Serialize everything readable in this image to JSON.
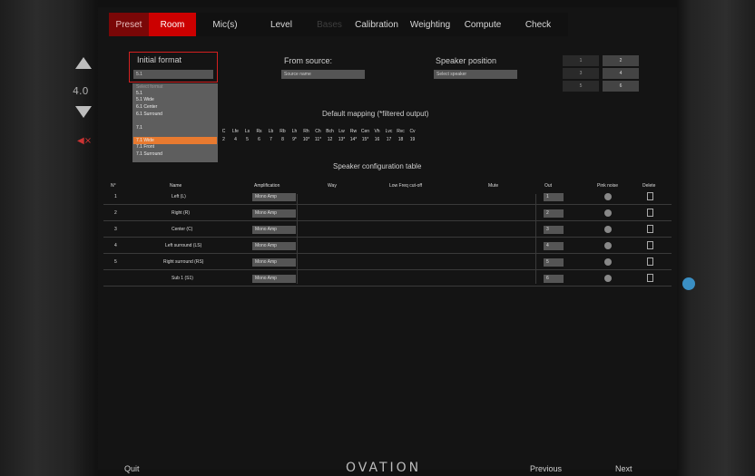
{
  "tabs": [
    {
      "label": "Preset",
      "state": "inactive"
    },
    {
      "label": "Room",
      "state": "active"
    },
    {
      "label": "Mic(s)",
      "state": "normal"
    },
    {
      "label": "Level",
      "state": "normal"
    },
    {
      "label": "Bases",
      "state": "disabled"
    },
    {
      "label": "Calibration",
      "state": "normal"
    },
    {
      "label": "Weighting",
      "state": "normal"
    },
    {
      "label": "Compute",
      "state": "normal"
    },
    {
      "label": "Check",
      "state": "normal"
    }
  ],
  "side": {
    "zoom": "4.0",
    "mute": "◀×"
  },
  "room": {
    "initial_format_label": "Initial format",
    "initial_format_value": "5.1",
    "from_source_label": "From source:",
    "from_source_value": "Source name",
    "speaker_position_label": "Speaker position",
    "speaker_position_value": "Select speaker",
    "dropdown_header": "Select format",
    "dropdown_items": [
      "5.1",
      "5.1 Wide",
      "6.1 Center",
      "6.1 Surround",
      "7.1",
      "7.1 Wide",
      "7.1 Front",
      "7.1 Surround"
    ],
    "dropdown_selected_index": 5,
    "view_buttons": [
      "1",
      "2",
      "3",
      "4",
      "5",
      "6"
    ]
  },
  "mapping": {
    "title": "Default mapping (*filtered output)",
    "labels": [
      "C",
      "Lfe",
      "Ls",
      "Rs",
      "Lb",
      "Rb",
      "Lh",
      "Rh",
      "Ch",
      "Bch",
      "Lw",
      "Rw",
      "Cen",
      "Vh",
      "Lvc",
      "Rvc",
      "Cv"
    ],
    "values": [
      "2",
      "4",
      "5",
      "6",
      "7",
      "8",
      "9*",
      "10*",
      "11*",
      "12",
      "13*",
      "14*",
      "15*",
      "16",
      "17",
      "18",
      "19"
    ]
  },
  "config": {
    "title": "Speaker configuration table",
    "headers": [
      "N°",
      "Name",
      "Amplification",
      "Way",
      "Low Freq cut-off",
      "Mute",
      "Out",
      "Pink noise",
      "Delete"
    ],
    "rows": [
      {
        "n": "1",
        "name": "Left (L)",
        "amp": "Mono Amp",
        "out": "1"
      },
      {
        "n": "2",
        "name": "Right (R)",
        "amp": "Mono Amp",
        "out": "2"
      },
      {
        "n": "3",
        "name": "Center (C)",
        "amp": "Mono Amp",
        "out": "3"
      },
      {
        "n": "4",
        "name": "Left surround (LS)",
        "amp": "Mono Amp",
        "out": "4"
      },
      {
        "n": "5",
        "name": "Right surround (RS)",
        "amp": "Mono Amp",
        "out": "5"
      },
      {
        "n": "",
        "name": "Sub 1 (S1)",
        "amp": "Mono Amp",
        "out": "6"
      }
    ]
  },
  "footer": {
    "quit": "Quit",
    "logo": "OVATION",
    "previous": "Previous",
    "next": "Next"
  },
  "colors": {
    "accent": "#cc0000",
    "highlight": "#e87a30",
    "info_dot": "#3a8fc4"
  }
}
